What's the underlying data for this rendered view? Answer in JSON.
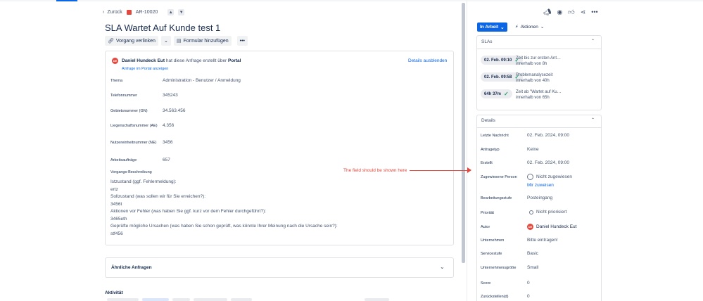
{
  "breadcrumb": {
    "back": "Zurück",
    "issue_key": "AR-10020"
  },
  "issue": {
    "title": "SLA Wartet Auf Kunde test 1"
  },
  "toolbar": {
    "link_issue": "Vorgang verlinken",
    "add_form": "Formular hinzufügen",
    "more": "•••"
  },
  "request": {
    "creator_name": "Daniel Hundeck Eut",
    "created_text": "hat diese Anfrage erstellt über",
    "channel": "Portal",
    "portal_link": "Anfrage im Portal anzeigen",
    "hide_details": "Details ausblenden",
    "avatar_initials": "DE",
    "fields": [
      {
        "label": "Thema",
        "value": "Administration - Benutzer / Anmeldung"
      },
      {
        "label": "Telefonnummer",
        "value": "345243"
      },
      {
        "label": "Gebietsnummer (GN)",
        "value": "34.563.456"
      },
      {
        "label": "Liegenschaftsnummer (AE)",
        "value": "4.356"
      },
      {
        "label": "Nutzereinheitnummer (NE)",
        "value": "3456"
      },
      {
        "label": "Arbeitsaufträge",
        "value": "657"
      }
    ],
    "description_label": "Vorgangs-Beschreibung",
    "description_lines": [
      "Istzustand (ggf. Fehlermeldung):",
      "ertz",
      "Sollzustand (was sollen wir für Sie erreichen?):",
      "3456t",
      "Aktionen vor Fehler (was haben Sie ggf. kurz vor dem Fehler durchgeführt?):",
      "3465eth",
      "Geprüfte mögliche Ursachen (was haben Sie schon geprüft, was könnte Ihrer Meinung nach die Ursache sein?):",
      "stf456"
    ]
  },
  "similar": {
    "label": "Ähnliche Anfragen"
  },
  "activity": {
    "label": "Aktivität"
  },
  "annotation": {
    "text": "The field should be shown here"
  },
  "sidebar": {
    "status": "In Arbeit",
    "actions": "Aktionen",
    "slas_title": "SLAs",
    "slas": [
      {
        "badge": "02. Feb. 09:10",
        "line1": "Zeit bis zur ersten Ant…",
        "line2": "innerhalb von 8h"
      },
      {
        "badge": "02. Feb. 09:58",
        "line1": "Problemanalysezeit",
        "line2": "innerhalb von 40h"
      },
      {
        "badge": "64h 37m",
        "line1": "Zeit ab \"Wartet auf Ku…",
        "line2": "innerhalb von 65h"
      }
    ],
    "details_title": "Details",
    "details": [
      {
        "label": "Letzte Nachricht",
        "value": "02. Feb. 2024, 09:00"
      },
      {
        "label": "Anfragetyp",
        "value": "Keine"
      },
      {
        "label": "Erstellt",
        "value": "02. Feb. 2024, 09:00"
      },
      {
        "label": "Zugewiesene Person",
        "value": "Nicht zugewiesen",
        "link": "Mir zuweisen"
      },
      {
        "label": "Bearbeitungsstufe",
        "value": "Posteingang"
      },
      {
        "label": "Priorität",
        "value": "Nicht priorisiert"
      },
      {
        "label": "Autor",
        "value": "Daniel Hundeck Eut"
      },
      {
        "label": "Unternehmen",
        "value": "Bitte eintragen!"
      },
      {
        "label": "Servicestufe",
        "value": "Basic"
      },
      {
        "label": "Unternehmensgröße",
        "value": "Small"
      },
      {
        "label": "Score",
        "value": "0"
      },
      {
        "label": "Zurückstellen(d)",
        "value": "0"
      }
    ]
  },
  "colors": {
    "accent": "#0c66e4",
    "danger": "#e2483d",
    "success": "#22a06b"
  }
}
